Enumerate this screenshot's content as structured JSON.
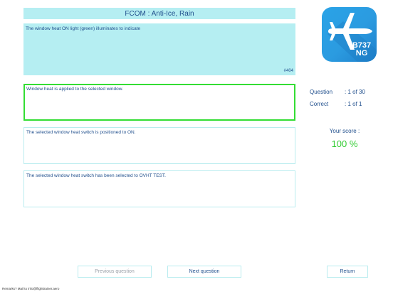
{
  "header": {
    "title": "FCOM : Anti-Ice, Rain"
  },
  "question": {
    "text": "The window heat ON light (green) illuminates to indicate",
    "id": "#404"
  },
  "answers": [
    {
      "text": "Window heat is applied to the selected window.",
      "selected": true
    },
    {
      "text": "The selected window heat switch is positioned to ON.",
      "selected": false
    },
    {
      "text": "The selected window heat switch has been selected to OVHT TEST.",
      "selected": false
    }
  ],
  "logo": {
    "line1": "B737",
    "line2": "NG",
    "icon": "airplane-icon"
  },
  "stats": {
    "question_label": "Question",
    "question_value": ": 1 of 30",
    "correct_label": "Correct",
    "correct_value": ": 1 of 1"
  },
  "score": {
    "label": "Your score :",
    "value": "100 %",
    "color": "#33cc33"
  },
  "buttons": {
    "previous": "Previous question",
    "next": "Next question",
    "return": "Return"
  },
  "footer": {
    "remarks": "Remarks? Mail to info@flighttrainer.aero"
  },
  "colors": {
    "panel": "#b5eef2",
    "text": "#1f4e8c",
    "selected_border": "#33dd33",
    "logo": "#2aa3e7"
  }
}
